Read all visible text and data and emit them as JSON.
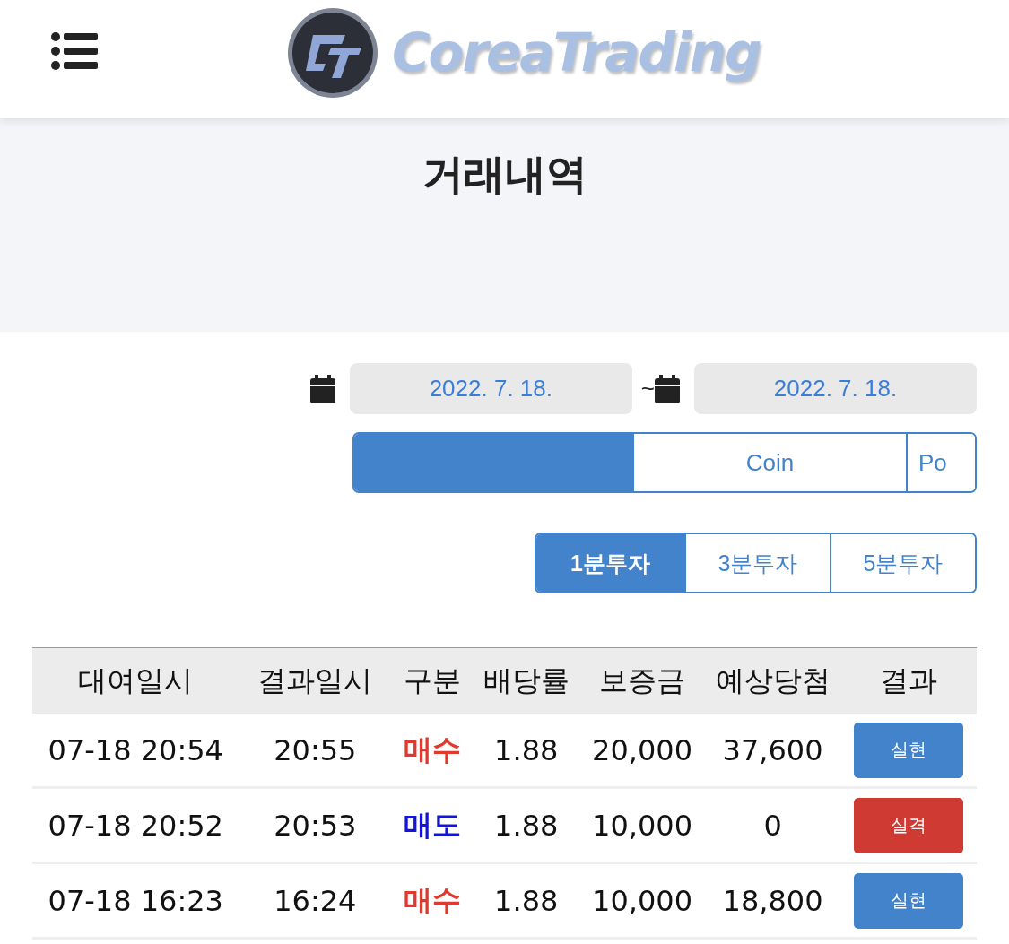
{
  "header": {
    "logo_text": "CoreaTrading"
  },
  "page_title": "거래내역",
  "date_range": {
    "from": "2022. 7. 18.",
    "separator": "~",
    "to": "2022. 7. 18."
  },
  "market_tabs": [
    {
      "selected": true
    },
    {
      "label": "Coin",
      "selected": false
    },
    {
      "label": "Po",
      "selected": false
    }
  ],
  "interval_tabs": [
    {
      "label": "1분투자",
      "selected": true
    },
    {
      "label": "3분투자",
      "selected": false
    },
    {
      "label": "5분투자",
      "selected": false
    }
  ],
  "table": {
    "columns": [
      "대여일시",
      "결과일시",
      "구분",
      "배당률",
      "보증금",
      "예상당첨",
      "결과"
    ],
    "rows": [
      {
        "start": "07-18 20:54",
        "end": "20:55",
        "side": {
          "text": "매수",
          "color": "#e03a2f"
        },
        "rate": "1.88",
        "deposit": "20,000",
        "expected": "37,600",
        "result": {
          "text": "실현",
          "color": "#4283cc"
        }
      },
      {
        "start": "07-18 20:52",
        "end": "20:53",
        "side": {
          "text": "매도",
          "color": "#1414d8"
        },
        "rate": "1.88",
        "deposit": "10,000",
        "expected": "0",
        "result": {
          "text": "실격",
          "color": "#cf3b33"
        }
      },
      {
        "start": "07-18 16:23",
        "end": "16:24",
        "side": {
          "text": "매수",
          "color": "#e03a2f"
        },
        "rate": "1.88",
        "deposit": "10,000",
        "expected": "18,800",
        "result": {
          "text": "실현",
          "color": "#4283cc"
        }
      }
    ]
  }
}
